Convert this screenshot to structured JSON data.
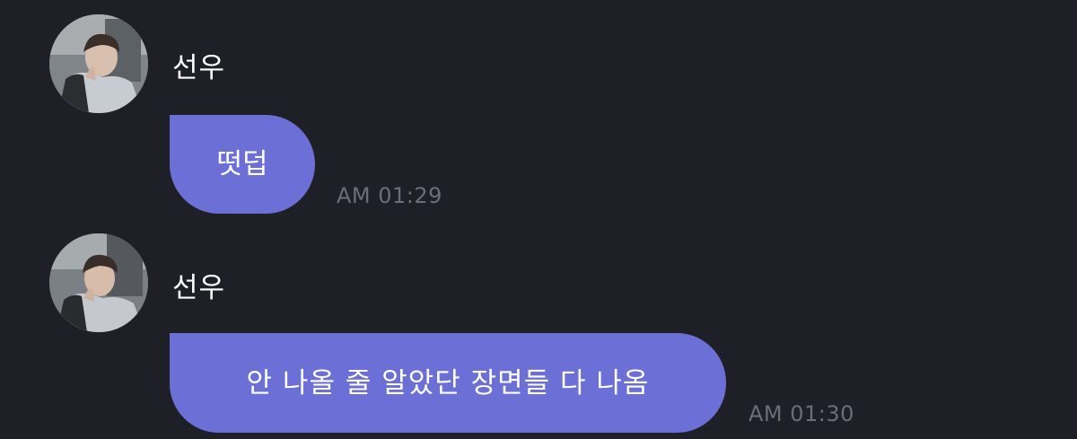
{
  "messages": [
    {
      "sender": "선우",
      "text": "떳덥",
      "time": "AM 01:29",
      "avatar_icon": "profile-photo"
    },
    {
      "sender": "선우",
      "text": "안 나올 줄 알았단 장면들 다 나옴",
      "time": "AM 01:30",
      "avatar_icon": "profile-photo"
    }
  ],
  "colors": {
    "background": "#1f1f27",
    "bubble": "#6c6fd5",
    "timestamp": "#6b6d78",
    "text": "#ffffff"
  }
}
